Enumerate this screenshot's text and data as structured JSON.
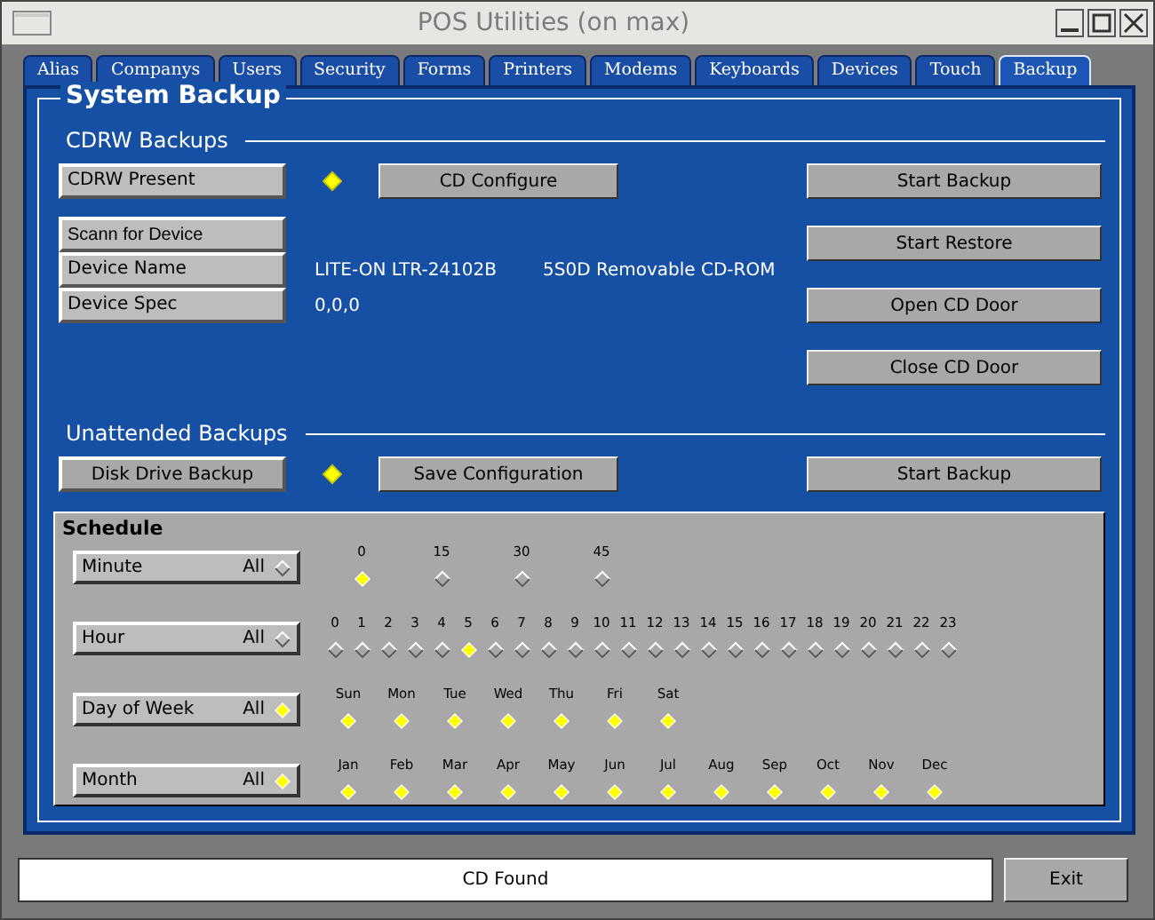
{
  "window": {
    "title": "POS Utilities (on max)"
  },
  "tabs": [
    {
      "label": "Alias",
      "selected": false
    },
    {
      "label": "Companys",
      "selected": false
    },
    {
      "label": "Users",
      "selected": false
    },
    {
      "label": "Security",
      "selected": false
    },
    {
      "label": "Forms",
      "selected": false
    },
    {
      "label": "Printers",
      "selected": false
    },
    {
      "label": "Modems",
      "selected": false
    },
    {
      "label": "Keyboards",
      "selected": false
    },
    {
      "label": "Devices",
      "selected": false
    },
    {
      "label": "Touch",
      "selected": false
    },
    {
      "label": "Backup",
      "selected": true
    }
  ],
  "page_title": "System Backup",
  "cdrw": {
    "heading": "CDRW Backups",
    "present": {
      "label": "CDRW Present",
      "on": true
    },
    "configure_button": "CD Configure",
    "scan_button": "Scann for Device",
    "device_name": {
      "label": "Device Name",
      "value": "LITE-ON  LTR-24102B",
      "type": "5S0D Removable CD-ROM"
    },
    "device_spec": {
      "label": "Device Spec",
      "value": "0,0,0"
    },
    "buttons": [
      "Start Backup",
      "Start Restore",
      "Open CD Door",
      "Close CD Door"
    ]
  },
  "unattended": {
    "heading": "Unattended Backups",
    "disk_backup": {
      "label": "Disk Drive Backup",
      "on": true
    },
    "save_button": "Save Configuration",
    "start_button": "Start Backup"
  },
  "schedule": {
    "title": "Schedule",
    "rows": [
      {
        "label": "Minute",
        "all_label": "All",
        "all_on": false,
        "options": [
          {
            "label": "0",
            "selected": true
          },
          {
            "label": "15",
            "selected": false
          },
          {
            "label": "30",
            "selected": false
          },
          {
            "label": "45",
            "selected": false
          }
        ]
      },
      {
        "label": "Hour",
        "all_label": "All",
        "all_on": false,
        "options": [
          {
            "label": "0",
            "selected": false
          },
          {
            "label": "1",
            "selected": false
          },
          {
            "label": "2",
            "selected": false
          },
          {
            "label": "3",
            "selected": false
          },
          {
            "label": "4",
            "selected": false
          },
          {
            "label": "5",
            "selected": true
          },
          {
            "label": "6",
            "selected": false
          },
          {
            "label": "7",
            "selected": false
          },
          {
            "label": "8",
            "selected": false
          },
          {
            "label": "9",
            "selected": false
          },
          {
            "label": "10",
            "selected": false
          },
          {
            "label": "11",
            "selected": false
          },
          {
            "label": "12",
            "selected": false
          },
          {
            "label": "13",
            "selected": false
          },
          {
            "label": "14",
            "selected": false
          },
          {
            "label": "15",
            "selected": false
          },
          {
            "label": "16",
            "selected": false
          },
          {
            "label": "17",
            "selected": false
          },
          {
            "label": "18",
            "selected": false
          },
          {
            "label": "19",
            "selected": false
          },
          {
            "label": "20",
            "selected": false
          },
          {
            "label": "21",
            "selected": false
          },
          {
            "label": "22",
            "selected": false
          },
          {
            "label": "23",
            "selected": false
          }
        ]
      },
      {
        "label": "Day of Week",
        "all_label": "All",
        "all_on": true,
        "options": [
          {
            "label": "Sun",
            "selected": true
          },
          {
            "label": "Mon",
            "selected": true
          },
          {
            "label": "Tue",
            "selected": true
          },
          {
            "label": "Wed",
            "selected": true
          },
          {
            "label": "Thu",
            "selected": true
          },
          {
            "label": "Fri",
            "selected": true
          },
          {
            "label": "Sat",
            "selected": true
          }
        ]
      },
      {
        "label": "Month",
        "all_label": "All",
        "all_on": true,
        "options": [
          {
            "label": "Jan",
            "selected": true
          },
          {
            "label": "Feb",
            "selected": true
          },
          {
            "label": "Mar",
            "selected": true
          },
          {
            "label": "Apr",
            "selected": true
          },
          {
            "label": "May",
            "selected": true
          },
          {
            "label": "Jun",
            "selected": true
          },
          {
            "label": "Jul",
            "selected": true
          },
          {
            "label": "Aug",
            "selected": true
          },
          {
            "label": "Sep",
            "selected": true
          },
          {
            "label": "Oct",
            "selected": true
          },
          {
            "label": "Nov",
            "selected": true
          },
          {
            "label": "Dec",
            "selected": true
          }
        ]
      }
    ]
  },
  "status": "CD Found",
  "exit_button": "Exit"
}
